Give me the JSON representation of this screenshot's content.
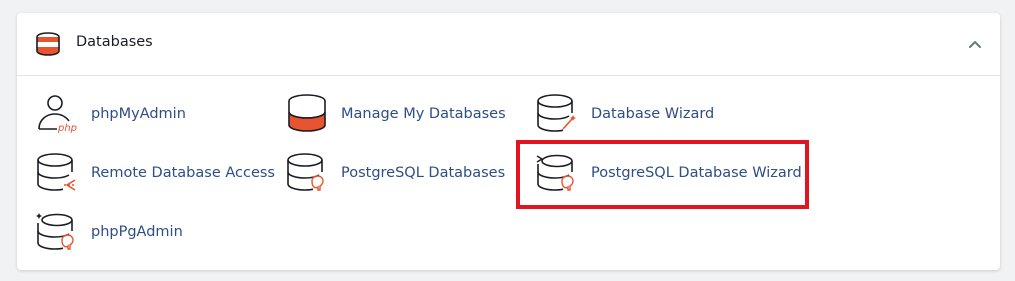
{
  "panel": {
    "title": "Databases",
    "header_icon": "database-stack-icon",
    "collapse_icon": "chevron-up-icon"
  },
  "items": [
    {
      "label": "phpMyAdmin",
      "icon": "phpmyadmin-icon"
    },
    {
      "label": "Manage My Databases",
      "icon": "database-icon"
    },
    {
      "label": "Database Wizard",
      "icon": "database-wizard-icon"
    },
    {
      "label": "Remote Database Access",
      "icon": "remote-database-icon"
    },
    {
      "label": "PostgreSQL Databases",
      "icon": "postgresql-database-icon"
    },
    {
      "label": "PostgreSQL Database Wizard",
      "icon": "postgresql-wizard-icon"
    },
    {
      "label": "phpPgAdmin",
      "icon": "phppgadmin-icon"
    }
  ],
  "colors": {
    "link": "#2d4e86",
    "accent_orange": "#e8542f",
    "icon_stroke": "#1a1d23",
    "highlight": "#e2141f",
    "php_text": "#e8542f"
  }
}
